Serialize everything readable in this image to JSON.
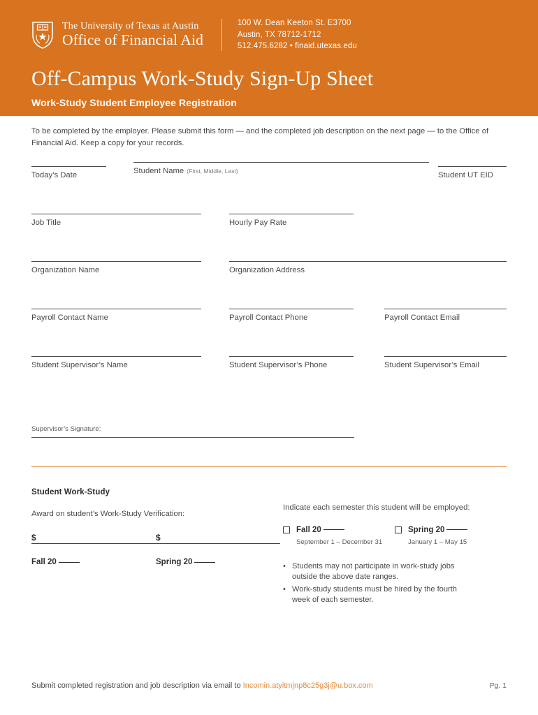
{
  "header": {
    "institution": "The University of Texas at Austin",
    "department": "Office of Financial Aid",
    "address_line1": "100 W. Dean Keeton St. E3700",
    "address_line2": "Austin, TX 78712-1712",
    "address_line3": "512.475.6282 • finaid.utexas.edu",
    "title": "Off-Campus Work-Study Sign-Up Sheet",
    "subtitle": "Work-Study Student Employee Registration",
    "brand_color": "#d8731f"
  },
  "intro": "To be completed by the employer. Please submit this form — and the completed job description on the next page — to the Office of Financial Aid. Keep a copy for your records.",
  "fields": {
    "todays_date": "Today’s Date",
    "student_name": "Student Name",
    "student_name_hint": "(First, Middle, Last)",
    "student_ut_eid": "Student UT EID",
    "job_title": "Job Title",
    "hourly_pay_rate": "Hourly Pay Rate",
    "organization_name": "Organization Name",
    "organization_address": "Organization Address",
    "payroll_contact_name": "Payroll Contact Name",
    "payroll_contact_phone": "Payroll Contact Phone",
    "payroll_contact_email": "Payroll Contact Email",
    "supervisor_name": "Student Supervisor’s Name",
    "supervisor_phone": "Student Supervisor’s Phone",
    "supervisor_email": "Student Supervisor’s Email",
    "supervisor_signature": "Supervisor’s Signature:"
  },
  "work_study": {
    "heading": "Student Work-Study",
    "award_label": "Award on student’s Work-Study Verification:",
    "currency_symbol": "$",
    "fall_term": "Fall  20",
    "spring_term": "Spring  20",
    "semester_prompt": "Indicate each semester this student will be employed:",
    "fall_check_label": "Fall  20",
    "spring_check_label": "Spring  20",
    "fall_range": "September 1 – December 31",
    "spring_range": "January 1 – May 15",
    "notes": [
      "Students may not participate in work-study jobs outside the above date ranges.",
      "Work-study students must be hired by the fourth week of each semester."
    ],
    "bullet": "•"
  },
  "footer": {
    "submit_text": "Submit completed registration and job description via email to ",
    "email": "Incomin.atyitmjnp8c25g3j@u.box.com",
    "page": "Pg. 1"
  }
}
